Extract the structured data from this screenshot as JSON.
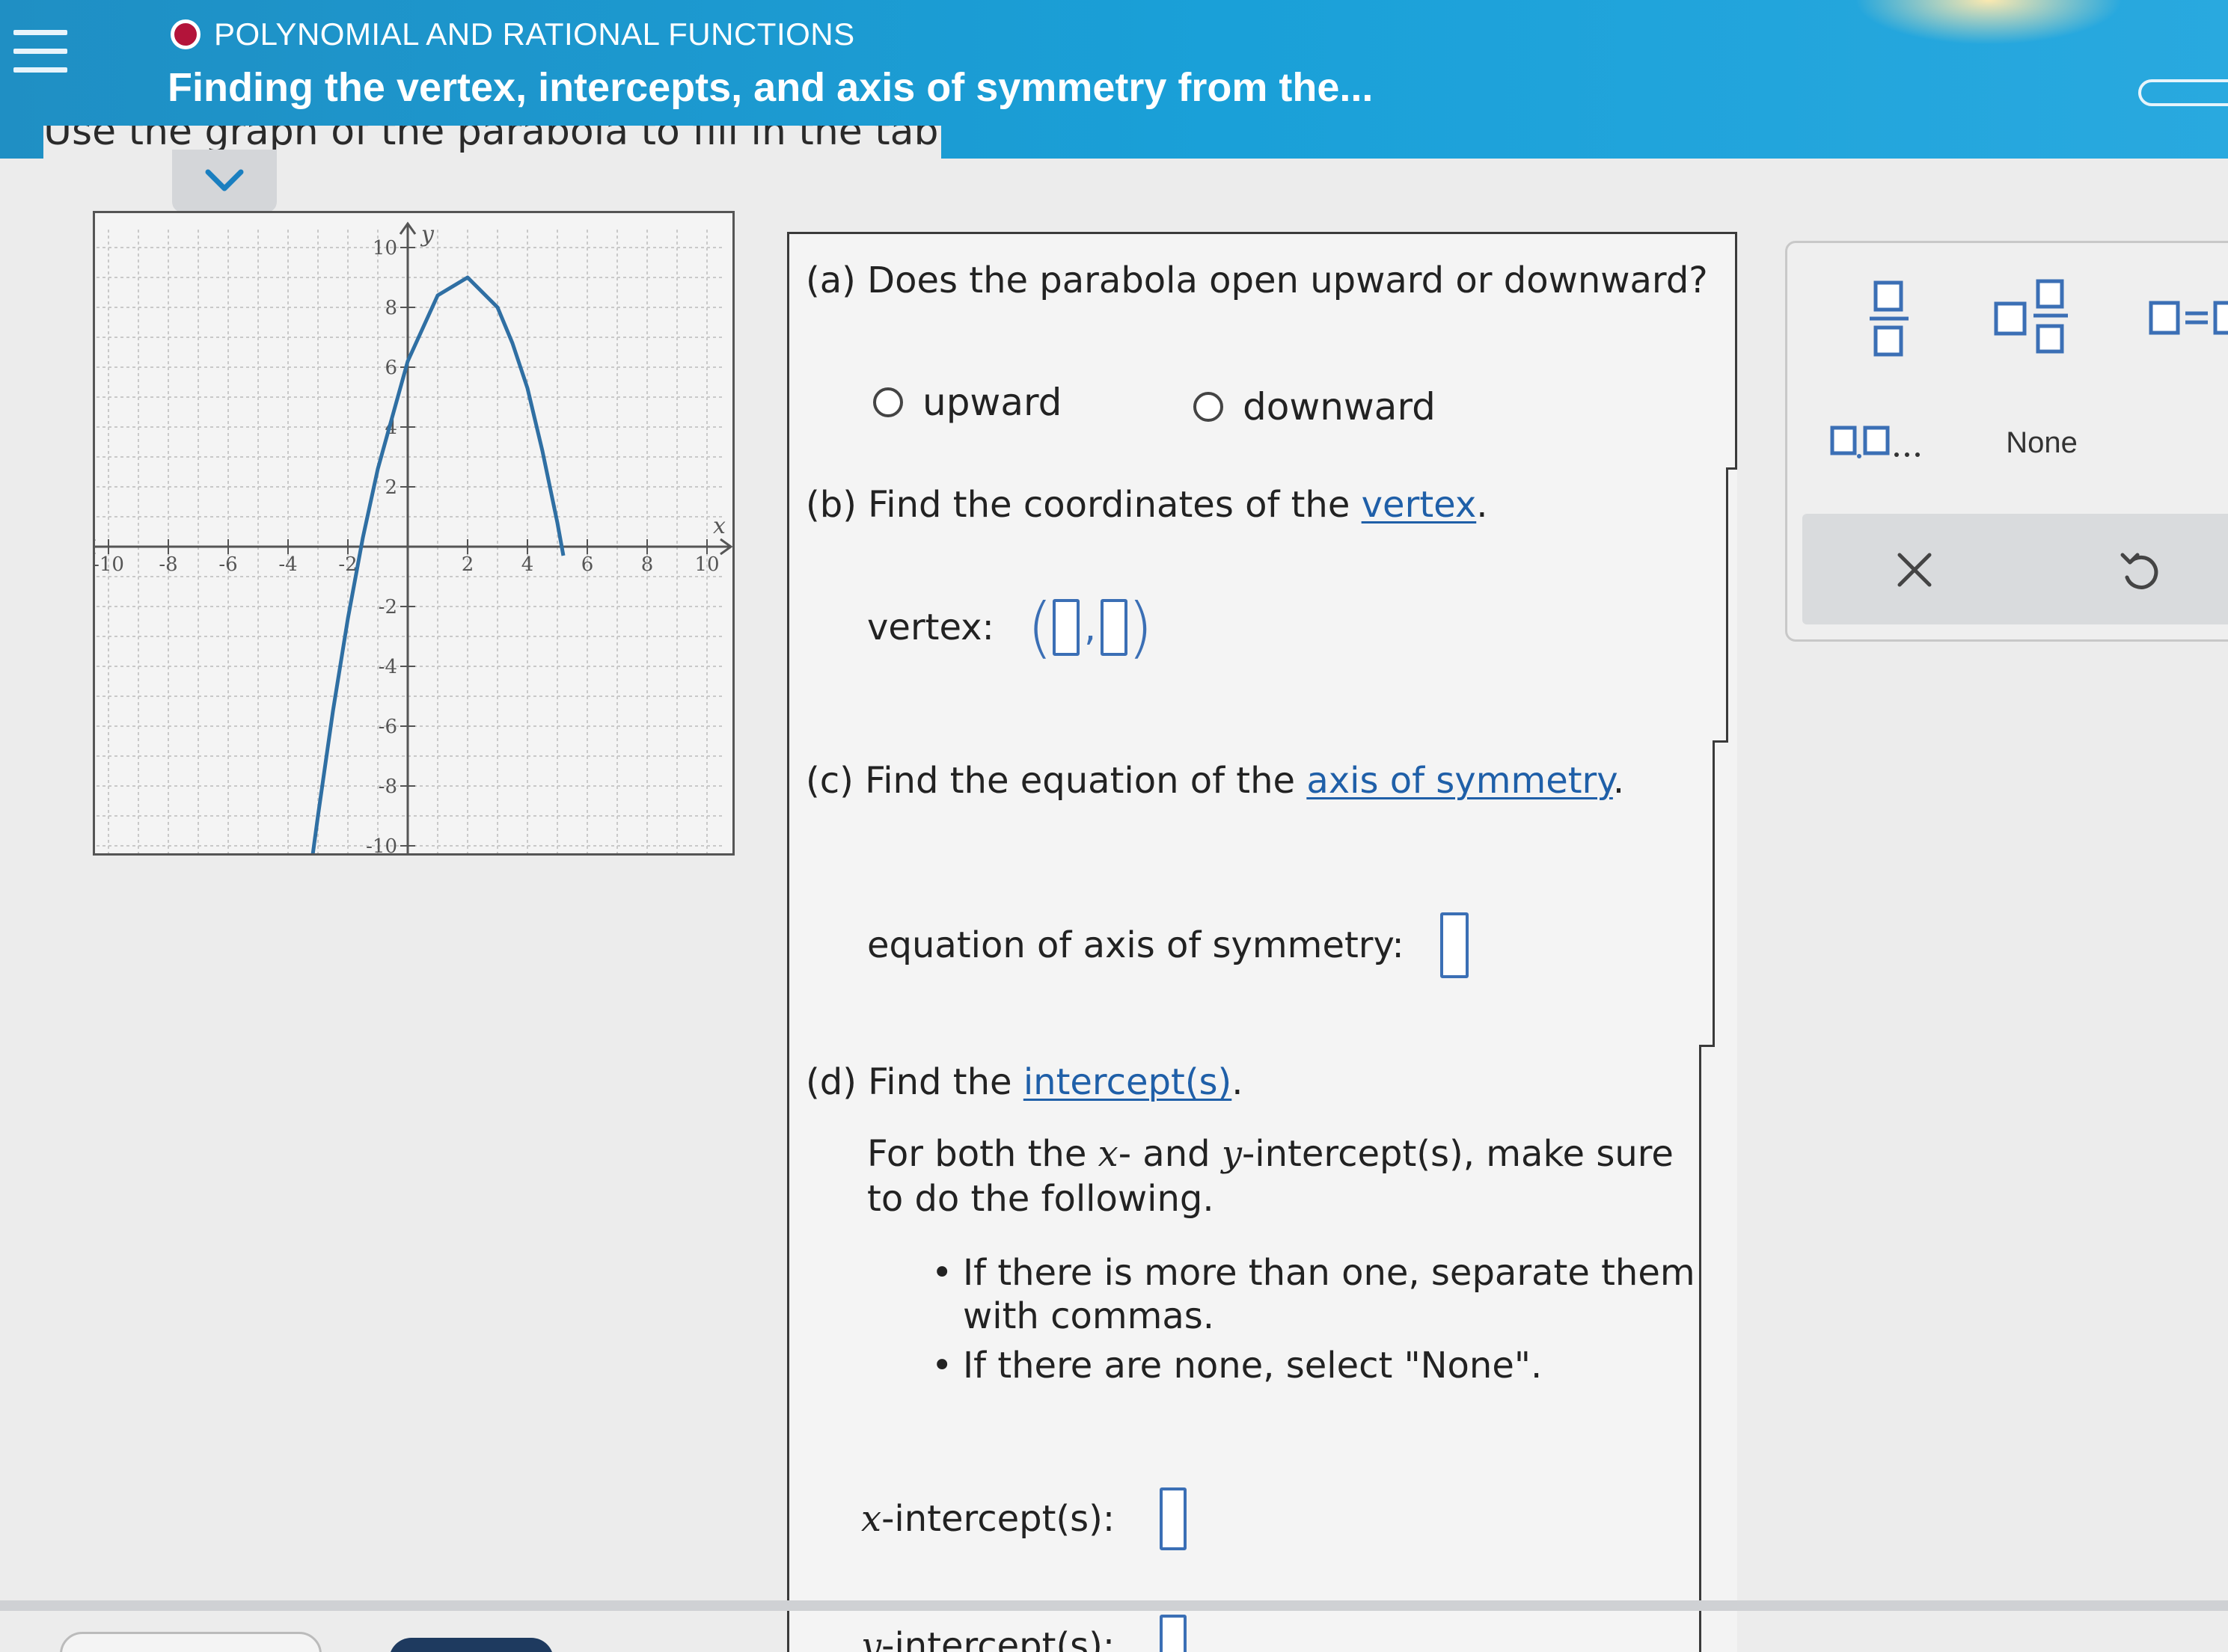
{
  "header": {
    "topic": "POLYNOMIAL AND RATIONAL FUNCTIONS",
    "title": "Finding the vertex, intercepts, and axis of symmetry from the...",
    "intro_partial": "Use the graph of the parabola to fill in the table."
  },
  "graph": {
    "x_label": "x",
    "y_label": "y",
    "x_ticks": [
      "-10",
      "-8",
      "-6",
      "-4",
      "-2",
      "2",
      "4",
      "6",
      "8",
      "10"
    ],
    "y_ticks": [
      "10",
      "8",
      "6",
      "4",
      "2",
      "-2",
      "-4",
      "-6",
      "-8",
      "-10"
    ],
    "xlim": [
      -10,
      10
    ],
    "ylim": [
      -10,
      10
    ],
    "grid": true
  },
  "chart_data": {
    "type": "line",
    "xlabel": "x",
    "ylabel": "y",
    "xlim": [
      -10,
      10
    ],
    "ylim": [
      -10,
      10
    ],
    "series": [
      {
        "x": [
          -3.2,
          -3,
          -2.5,
          -2,
          -1.5,
          -1,
          0,
          1,
          2,
          3,
          3.5,
          4,
          4.5,
          5,
          5.2
        ],
        "y": [
          -10.48,
          -9,
          -5.5,
          -2.4,
          0.3,
          2.6,
          6.2,
          8.4,
          9.0,
          8.0,
          6.8,
          5.3,
          3.2,
          0.8,
          -0.3
        ]
      }
    ]
  },
  "questions": {
    "a": {
      "prompt": "(a) Does the parabola open upward or downward?",
      "option_up": "upward",
      "option_down": "downward"
    },
    "b": {
      "prompt_pre": "(b) Find the coordinates of the ",
      "prompt_link": "vertex",
      "prompt_post": ".",
      "label": "vertex:",
      "comma": ","
    },
    "c": {
      "prompt_pre": "(c) Find the equation of the ",
      "prompt_link": "axis of symmetry",
      "prompt_post": ".",
      "label": "equation of axis of symmetry:"
    },
    "d": {
      "prompt_pre": "(d) Find the ",
      "prompt_link": "intercept(s)",
      "prompt_post": ".",
      "instr_pre": "For both the ",
      "instr_x": "x",
      "instr_mid": "- and ",
      "instr_y": "y",
      "instr_post": "-intercept(s), make sure",
      "instr_line2": "to do the following.",
      "bullet1_line1": "If there is more than one, separate them",
      "bullet1_line2": "with commas.",
      "bullet2": "If there are none, select \"None\".",
      "x_var": "x",
      "x_label": "-intercept(s):",
      "y_var": "y",
      "y_label": "-intercept(s):"
    }
  },
  "toolbar": {
    "none_label": "None",
    "list_ellipsis": ",..."
  },
  "colors": {
    "header": "#1a9bd4",
    "accent": "#3b6fb5",
    "curve": "#2f6fa3",
    "topic_dot": "#b3143a"
  }
}
